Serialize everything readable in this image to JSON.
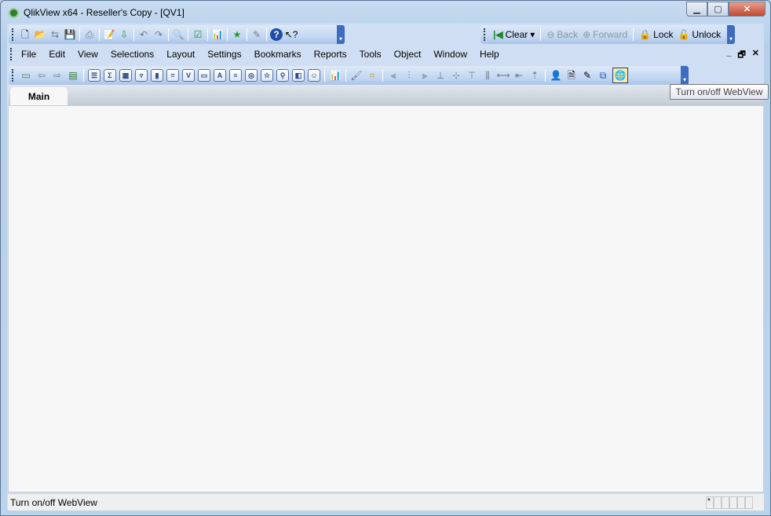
{
  "window": {
    "title": "QlikView x64 - Reseller's Copy - [QV1]"
  },
  "toolbar_main": {
    "icons": [
      "new",
      "open",
      "reload",
      "save",
      "print",
      "edit-script",
      "reload-data",
      "undo",
      "redo",
      "search",
      "select-fields",
      "chart-wizard",
      "favorite",
      "properties",
      "help",
      "context-help"
    ]
  },
  "toolbar_nav": {
    "clear": "Clear",
    "back": "Back",
    "forward": "Forward",
    "lock": "Lock",
    "unlock": "Unlock"
  },
  "menu": {
    "items": [
      "File",
      "Edit",
      "View",
      "Selections",
      "Layout",
      "Settings",
      "Bookmarks",
      "Reports",
      "Tools",
      "Object",
      "Window",
      "Help"
    ]
  },
  "toolbar_design": {
    "active": "webview"
  },
  "tabs": [
    {
      "label": "Main"
    }
  ],
  "tooltip": "Turn on/off WebView",
  "status": {
    "text": "Turn on/off WebView",
    "indicator": "*"
  }
}
